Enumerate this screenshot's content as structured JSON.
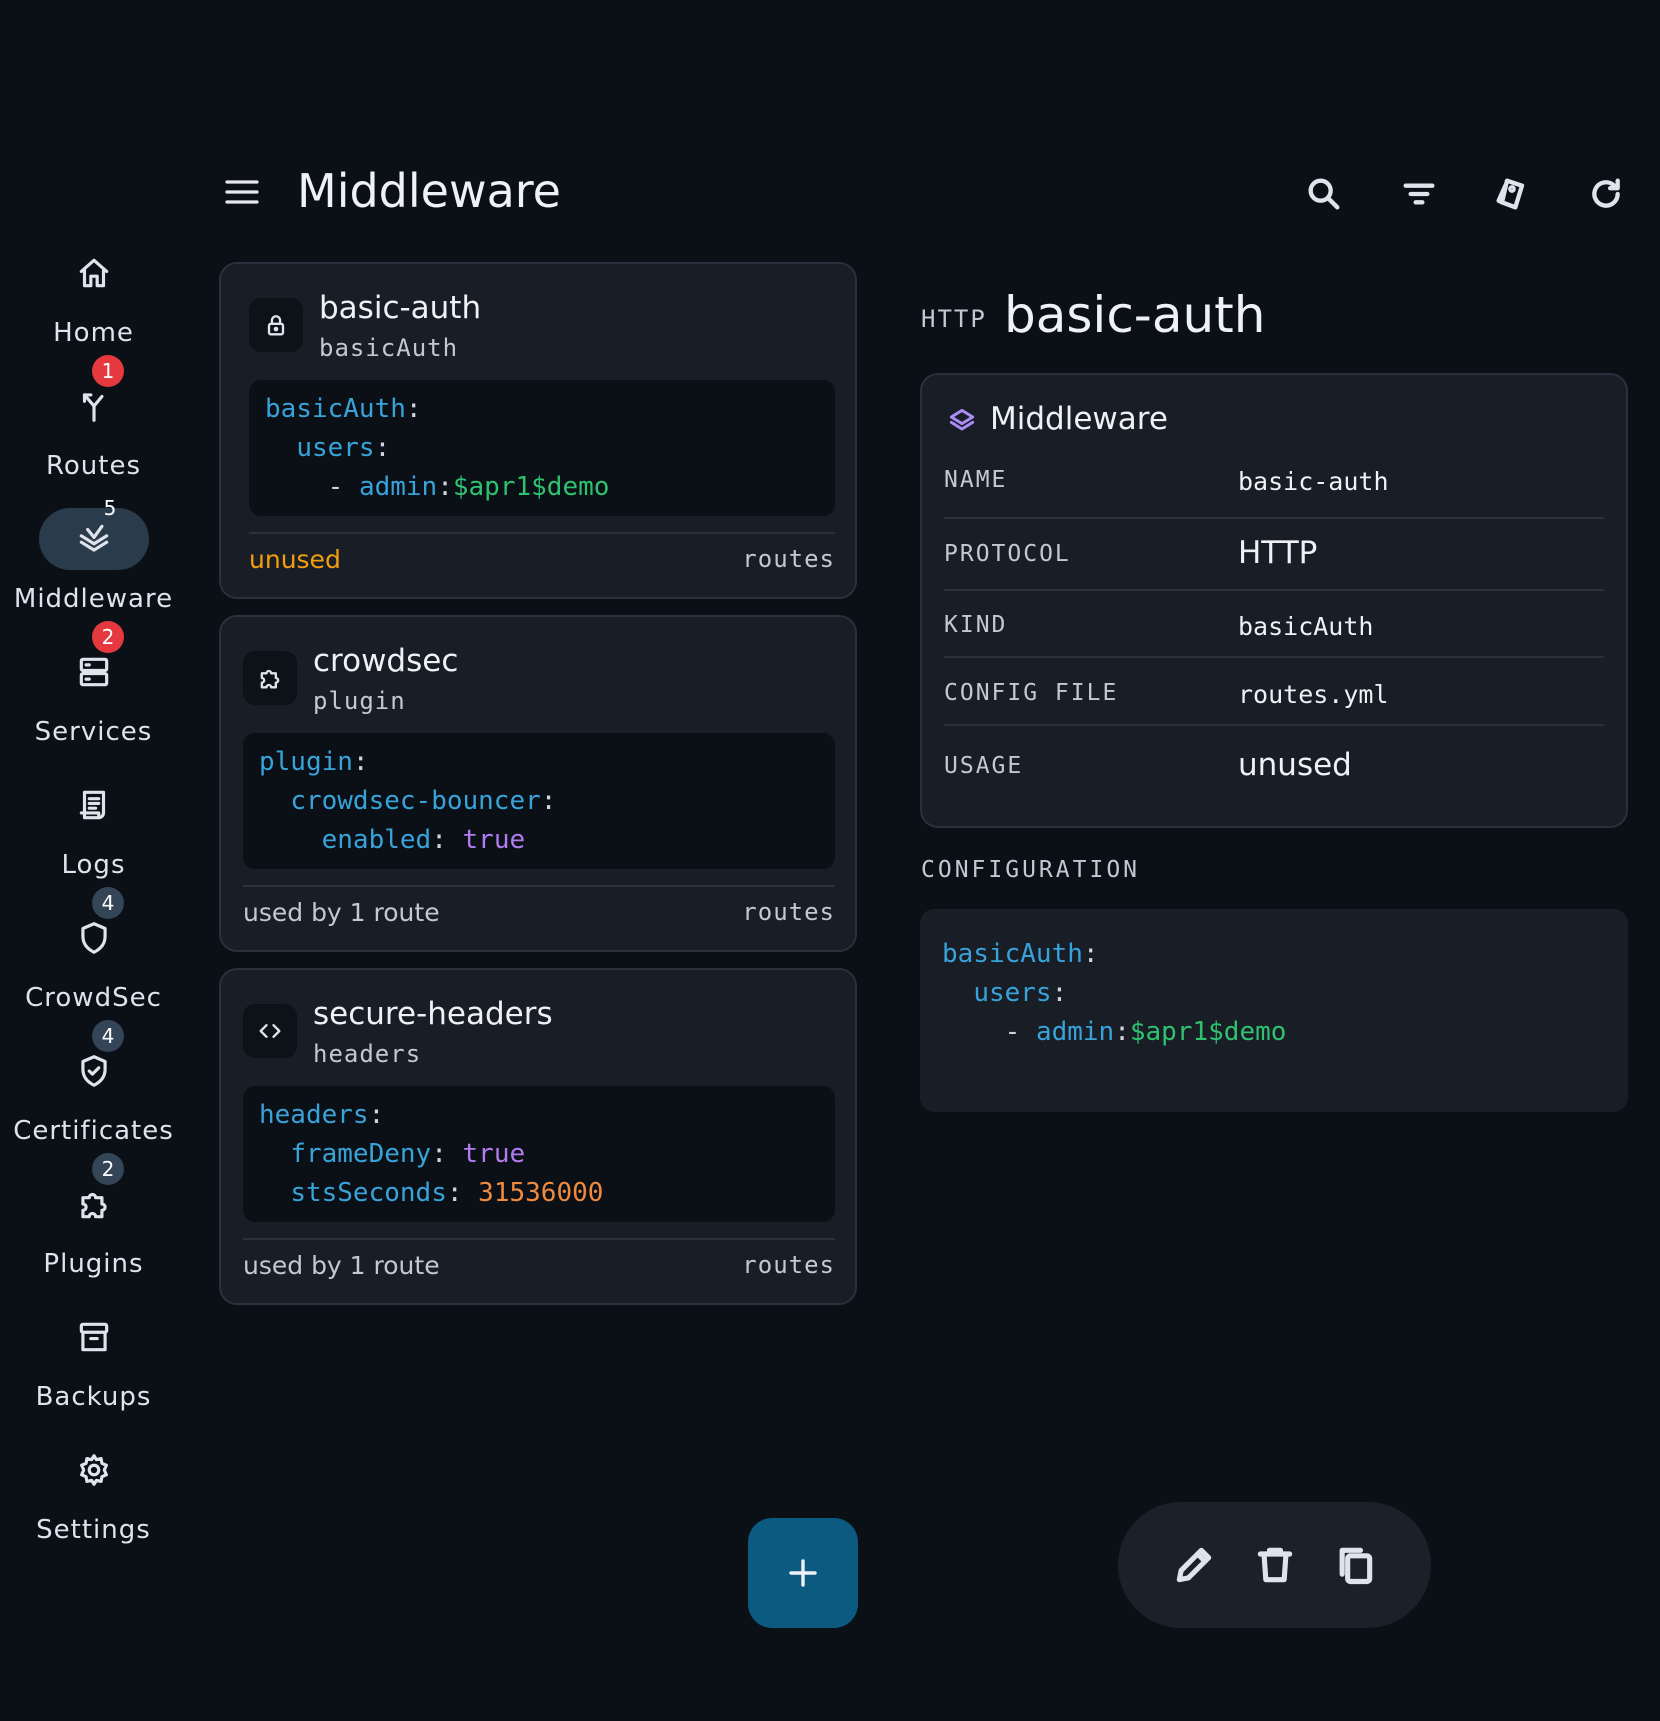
{
  "header": {
    "title": "Middleware",
    "menu_icon": "menu-icon",
    "tools": [
      "search-icon",
      "filter-icon",
      "tags-icon",
      "refresh-icon"
    ]
  },
  "nav": [
    {
      "label": "Home",
      "icon": "home-icon",
      "badge": ""
    },
    {
      "label": "Routes",
      "icon": "routes-icon",
      "badge": "1"
    },
    {
      "label": "Middleware",
      "icon": "layers-icon",
      "badge": "5",
      "active": true
    },
    {
      "label": "Services",
      "icon": "server-icon",
      "badge": "2"
    },
    {
      "label": "Logs",
      "icon": "logs-icon",
      "badge": ""
    },
    {
      "label": "CrowdSec",
      "icon": "shield-icon",
      "badge": "4"
    },
    {
      "label": "Certificates",
      "icon": "shield-check-icon",
      "badge": "4"
    },
    {
      "label": "Plugins",
      "icon": "puzzle-icon",
      "badge": "2"
    },
    {
      "label": "Backups",
      "icon": "archive-icon",
      "badge": ""
    },
    {
      "label": "Settings",
      "icon": "gear-icon",
      "badge": ""
    }
  ],
  "cards": [
    {
      "name": "basic-auth",
      "kind": "basicAuth",
      "icon": "lock-icon",
      "code": {
        "l1": "basicAuth",
        "l2": "users",
        "l3_key": "admin",
        "l3_val": "$apr1$demo"
      },
      "usage": "unused",
      "link": "routes"
    },
    {
      "name": "crowdsec",
      "kind": "plugin",
      "icon": "puzzle-icon",
      "code": {
        "l1": "plugin",
        "l2": "crowdsec-bouncer",
        "l3_key": "enabled",
        "l3_val": "true"
      },
      "usage": "used by 1 route",
      "link": "routes"
    },
    {
      "name": "secure-headers",
      "kind": "headers",
      "icon": "code-icon",
      "code": {
        "l1": "headers",
        "l2_key": "frameDeny",
        "l2_val": "true",
        "l3_key": "stsSeconds",
        "l3_val": "31536000"
      },
      "usage": "used by 1 route",
      "link": "routes"
    }
  ],
  "detail": {
    "protocol_tag": "HTTP",
    "title": "basic-auth",
    "section_title": "Middleware",
    "section_icon": "layers-icon",
    "rows": [
      {
        "key": "NAME",
        "value": "basic-auth"
      },
      {
        "key": "PROTOCOL",
        "value": "HTTP"
      },
      {
        "key": "KIND",
        "value": "basicAuth"
      },
      {
        "key": "CONFIG FILE",
        "value": "routes.yml"
      },
      {
        "key": "USAGE",
        "value": "unused"
      }
    ],
    "config_label": "CONFIGURATION",
    "config": {
      "l1": "basicAuth",
      "l2": "users",
      "l3_key": "admin",
      "l3_val": "$apr1$demo"
    }
  },
  "actions": {
    "fab_icon": "plus-icon",
    "bar": [
      "edit-icon",
      "delete-icon",
      "copy-icon"
    ]
  },
  "colors": {
    "background": "#0b0f16",
    "card": "#181d26",
    "accent": "#0c5a80",
    "badge_red": "#e5393f",
    "yaml_key": "#38a3d9",
    "yaml_string": "#2ec26f",
    "yaml_bool": "#b07cf0",
    "yaml_number": "#f08a3c",
    "unused": "#f59e0b"
  }
}
